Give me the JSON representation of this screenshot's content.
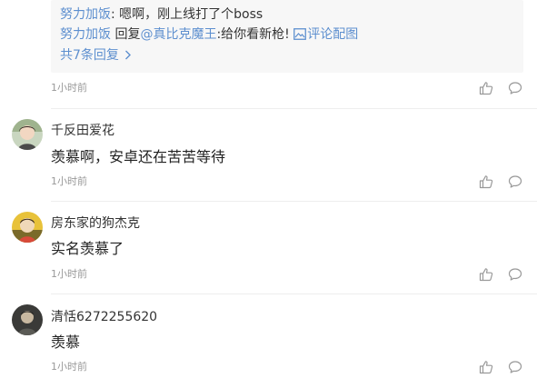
{
  "reply_preview": {
    "line1": {
      "author": "努力加饭",
      "sep": ":",
      "text": "嗯啊，刚上线打了个boss"
    },
    "line2": {
      "author": "努力加饭",
      "reply_word": "回复",
      "target": "@真比克魔王",
      "text": ":给你看新枪!",
      "pic_label": "评论配图"
    },
    "more_label": "共7条回复",
    "more_icon": "chevron-right-icon"
  },
  "comments": [
    {
      "time": "1小时前"
    },
    {
      "user": "千反田爱花",
      "text": "羡慕啊，安卓还在苦苦等待",
      "time": "1小时前"
    },
    {
      "user": "房东家的狗杰克",
      "text": "实名羡慕了",
      "time": "1小时前"
    },
    {
      "user": "清恬6272255620",
      "text": "羡慕",
      "time": "1小时前"
    }
  ],
  "colors": {
    "link": "#5d8fcf",
    "meta": "#999999",
    "reply_bg": "#f7f7f7"
  }
}
